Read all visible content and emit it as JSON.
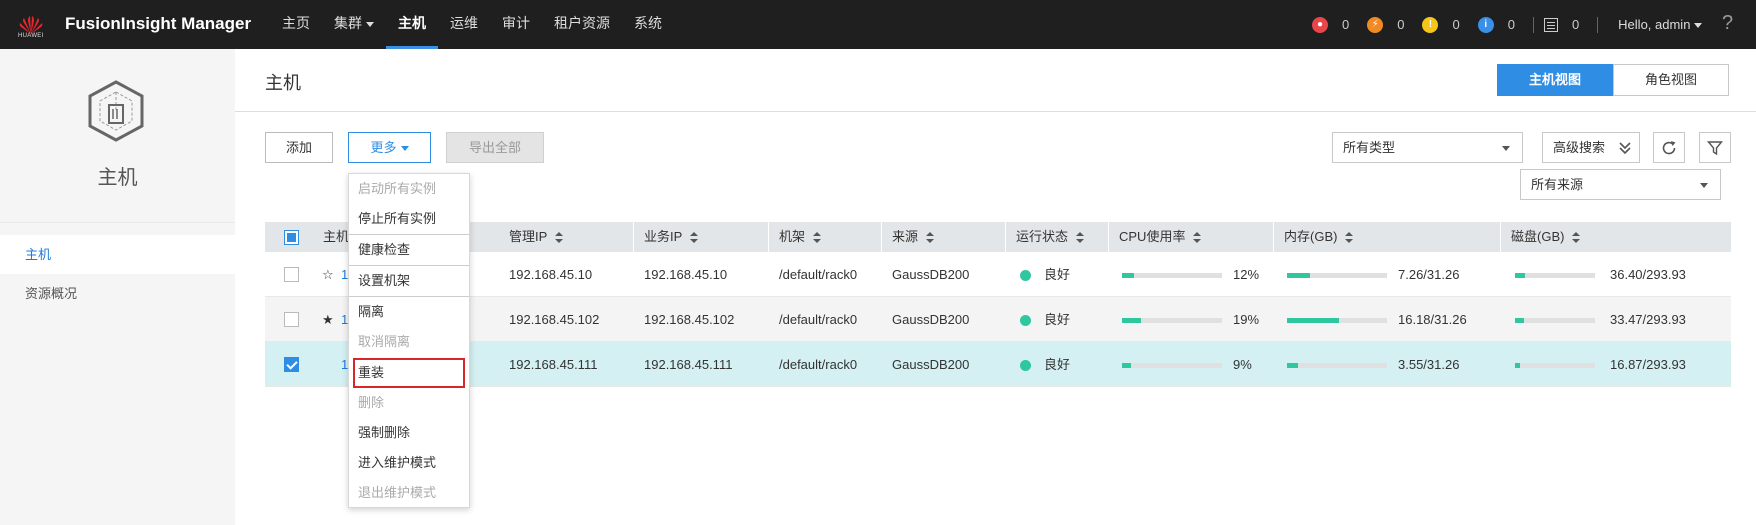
{
  "topbar": {
    "brand": "HUAWEI",
    "app_title": "FusionInsight Manager",
    "nav": [
      {
        "label": "主页"
      },
      {
        "label": "集群"
      },
      {
        "label": "主机"
      },
      {
        "label": "运维"
      },
      {
        "label": "审计"
      },
      {
        "label": "租户资源"
      },
      {
        "label": "系统"
      }
    ],
    "alarms": [
      {
        "count": "0",
        "color": "#e8464a",
        "glyph": "🔥"
      },
      {
        "count": "0",
        "color": "#f08a24",
        "glyph": "⚡"
      },
      {
        "count": "0",
        "color": "#f5c518",
        "glyph": "!"
      },
      {
        "count": "0",
        "color": "#3a8fe6",
        "glyph": "i"
      }
    ],
    "tasks_count": "0",
    "user_greeting": "Hello, admin",
    "help": "?"
  },
  "sidebar": {
    "title": "主机",
    "items": [
      {
        "label": "主机"
      },
      {
        "label": "资源概况"
      }
    ]
  },
  "page": {
    "title": "主机",
    "view_host": "主机视图",
    "view_role": "角色视图"
  },
  "toolbar": {
    "add": "添加",
    "more": "更多",
    "export_all": "导出全部",
    "type_filter": "所有类型",
    "advanced_search": "高级搜索",
    "source_filter": "所有来源"
  },
  "table": {
    "headers": [
      "主机",
      "管理IP",
      "业务IP",
      "机架",
      "来源",
      "运行状态",
      "CPU使用率",
      "内存(GB)",
      "磁盘(GB)"
    ],
    "rows": [
      {
        "star": "☆",
        "host": "1",
        "mgmt_ip": "192.168.45.10",
        "biz_ip": "192.168.45.10",
        "rack": "/default/rack0",
        "source": "GaussDB200",
        "status": "良好",
        "cpu": "12%",
        "cpu_frac": 0.12,
        "mem": "7.26/31.26",
        "mem_frac": 0.232,
        "disk": "36.40/293.93",
        "disk_frac": 0.124,
        "checked": false
      },
      {
        "star": "★",
        "host": "1",
        "mgmt_ip": "192.168.45.102",
        "biz_ip": "192.168.45.102",
        "rack": "/default/rack0",
        "source": "GaussDB200",
        "status": "良好",
        "cpu": "19%",
        "cpu_frac": 0.19,
        "mem": "16.18/31.26",
        "mem_frac": 0.518,
        "disk": "33.47/293.93",
        "disk_frac": 0.114,
        "checked": false
      },
      {
        "star": "",
        "host": "1",
        "mgmt_ip": "192.168.45.111",
        "biz_ip": "192.168.45.111",
        "rack": "/default/rack0",
        "source": "GaussDB200",
        "status": "良好",
        "cpu": "9%",
        "cpu_frac": 0.09,
        "mem": "3.55/31.26",
        "mem_frac": 0.114,
        "disk": "16.87/293.93",
        "disk_frac": 0.057,
        "checked": true
      }
    ]
  },
  "more_menu": {
    "items": [
      {
        "label": "启动所有实例",
        "disabled": true
      },
      {
        "label": "停止所有实例",
        "disabled": false
      },
      {
        "label": "健康检查",
        "disabled": false
      },
      {
        "label": "设置机架",
        "disabled": false
      },
      {
        "label": "隔离",
        "disabled": false
      },
      {
        "label": "取消隔离",
        "disabled": true
      },
      {
        "label": "重装",
        "disabled": false
      },
      {
        "label": "删除",
        "disabled": true
      },
      {
        "label": "强制删除",
        "disabled": false
      },
      {
        "label": "进入维护模式",
        "disabled": false
      },
      {
        "label": "退出维护模式",
        "disabled": true
      }
    ]
  },
  "colors": {
    "accent": "#2f8de4",
    "status_good": "#2ec7a0",
    "selected_row": "#d4f0f2",
    "highlight_box": "#d9262c"
  }
}
